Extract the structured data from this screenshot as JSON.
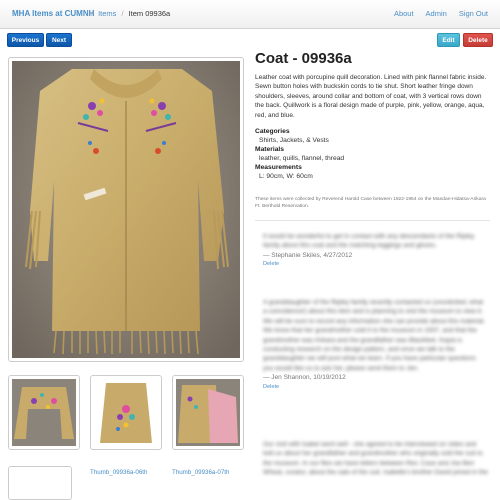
{
  "nav": {
    "brand": "MHA Items at CUMNH",
    "crumb_items": "Items",
    "crumb_current": "Item 09936a",
    "sep": "/",
    "about": "About",
    "admin": "Admin",
    "signout": "Sign Out"
  },
  "toolbar": {
    "previous": "Previous",
    "next": "Next",
    "edit": "Edit",
    "delete": "Delete"
  },
  "item": {
    "title": "Coat - 09936a",
    "description": "Leather coat with porcupine quill decoration. Lined with pink flannel fabric inside. Sewn button holes with buckskin cords to tie shut. Short leather fringe down shoulders, sleeves, around collar and bottom of coat, with 3 vertical rows down the back. Quillwork is a floral design made of purple, pink, yellow, orange, aqua, red, and blue.",
    "categories_label": "Categories",
    "categories_value": "Shirts, Jackets, & Vests",
    "materials_label": "Materials",
    "materials_value": "leather, quills, flannel, thread",
    "measurements_label": "Measurements",
    "measurements_value": "L: 90cm, W: 60cm",
    "note": "These items were collected by Reverend Harold Case between 1922-1954 on the Mandan-Hidatsa-Arikara Ft. Berthold Reservation."
  },
  "thumbnails": [
    {
      "caption": ""
    },
    {
      "caption": "Thumb_09936a-06th"
    },
    {
      "caption": "Thumb_09936a-07th"
    }
  ],
  "comments": [
    {
      "text": "It would be wonderful to get in contact with any descendants of the Ripley family about this coat and the matching leggings and gloves.",
      "author": "— Stephanie Skiles, 4/27/2012",
      "delete": "Delete"
    },
    {
      "text": "A granddaughter of the Ripley family recently contacted us (unsolicited, what a coincidence!) about this item and is planning to visit the museum to view it. We will be sure to record any information she can provide about this material. We know that her grandmother sold it to the museum in 1937, and that the grandmother was Arikara and the grandfather was Blackfeet. Kayla is conducting research on the design pattern, and once we talk to the granddaughter we will post what we learn. If you have particular questions you would like us to ask her, please send them to Jen.",
      "author": "— Jen Shannon, 10/19/2012",
      "delete": "Delete"
    },
    {
      "text": "Our visit with Isabel went well - she agreed to be interviewed on video and told us about her grandfather and grandmother who originally sold the suit to the museum. In our files we have letters between Rev. Case and Joe Ben Wheat, curator, about the sale of the suit. Isabelle's brother David joined in the",
      "author": "",
      "delete": ""
    }
  ],
  "colors": {
    "link": "#4a8fc7",
    "primary": "#0c56a8",
    "info": "#3aa7c8",
    "danger": "#c53c36"
  }
}
